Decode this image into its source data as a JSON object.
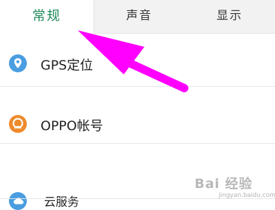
{
  "tabs": [
    {
      "label": "常规",
      "active": true
    },
    {
      "label": "声音",
      "active": false
    },
    {
      "label": "显示",
      "active": false
    }
  ],
  "settings_items": [
    {
      "label": "GPS定位",
      "icon": "location-pin-icon",
      "icon_color": "#4a9de0"
    },
    {
      "label": "OPPO帐号",
      "icon": "account-icon",
      "icon_color": "#ee8a2b"
    },
    {
      "label": "云服务",
      "icon": "cloud-icon",
      "icon_color": "#4a9de0"
    }
  ],
  "colors": {
    "active_tab_text": "#1e8a5a",
    "annotation_arrow": "#ff00ff"
  },
  "watermark": {
    "text": "Bai 经验",
    "subtext": "jingyan.baidu.com"
  }
}
